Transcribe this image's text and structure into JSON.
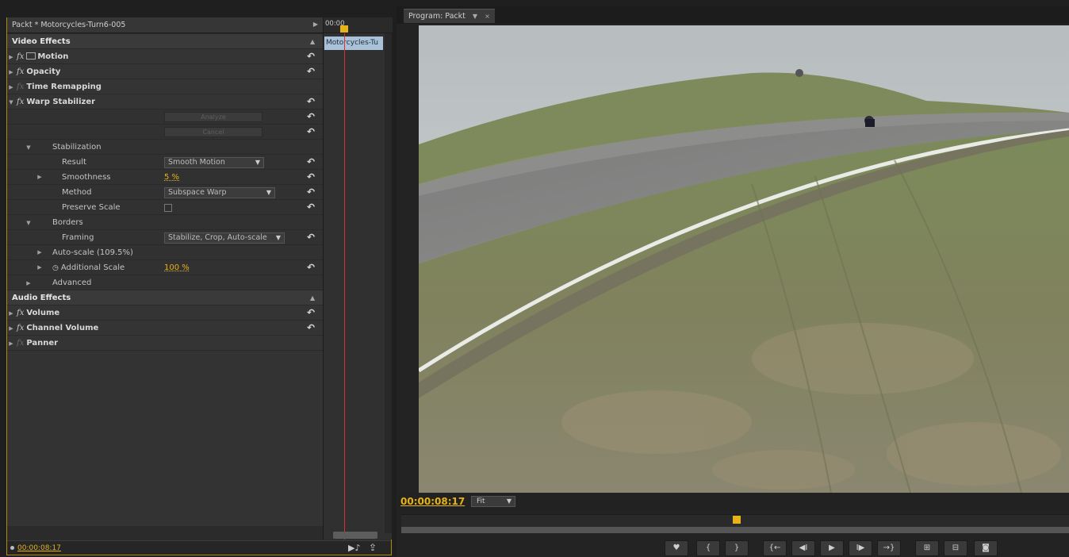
{
  "effect_controls": {
    "header_title": "Packt * Motorcycles-Turn6-005",
    "mini_timeline": {
      "timecode": "00:00",
      "clip_label": "Motorcycles-Tu"
    },
    "video_effects_label": "Video Effects",
    "motion_label": "Motion",
    "opacity_label": "Opacity",
    "time_remapping_label": "Time Remapping",
    "warp_stabilizer_label": "Warp Stabilizer",
    "analyze_label": "Analyze",
    "cancel_label": "Cancel",
    "stabilization_label": "Stabilization",
    "result_label": "Result",
    "result_value": "Smooth Motion",
    "smoothness_label": "Smoothness",
    "smoothness_value": "5 %",
    "method_label": "Method",
    "method_value": "Subspace Warp",
    "preserve_scale_label": "Preserve Scale",
    "borders_label": "Borders",
    "framing_label": "Framing",
    "framing_value": "Stabilize, Crop, Auto-scale",
    "autoscale_label": "Auto-scale (109.5%)",
    "additional_scale_label": "Additional Scale",
    "additional_scale_value": "100 %",
    "advanced_label": "Advanced",
    "audio_effects_label": "Audio Effects",
    "volume_label": "Volume",
    "channel_volume_label": "Channel Volume",
    "panner_label": "Panner",
    "fx_mark": "fx",
    "footer_timecode": "00:00:08:17"
  },
  "program_monitor": {
    "tab_label": "Program: Packt",
    "timecode": "00:00:08:17",
    "fit_label": "Fit",
    "transport": [
      {
        "name": "add-marker-button",
        "glyph": "♥"
      },
      {
        "name": "mark-in-button",
        "glyph": "{"
      },
      {
        "name": "mark-out-button",
        "glyph": "}"
      },
      {
        "name": "go-to-in-button",
        "glyph": "{←"
      },
      {
        "name": "step-back-button",
        "glyph": "◀I"
      },
      {
        "name": "play-button",
        "glyph": "▶"
      },
      {
        "name": "step-forward-button",
        "glyph": "I▶"
      },
      {
        "name": "go-to-out-button",
        "glyph": "→}"
      },
      {
        "name": "lift-button",
        "glyph": "⊞"
      },
      {
        "name": "extract-button",
        "glyph": "⊟"
      },
      {
        "name": "export-frame-button",
        "glyph": "◙"
      }
    ]
  },
  "colors": {
    "accent": "#e6b319",
    "playhead": "#d9302b",
    "clip": "#a9c2d8"
  }
}
